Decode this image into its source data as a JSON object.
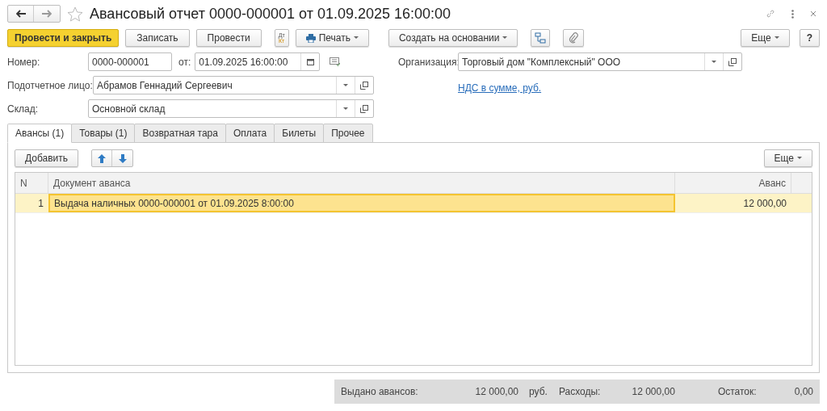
{
  "window": {
    "title": "Авансовый отчет 0000-000001 от 01.09.2025 16:00:00",
    "favorite": false
  },
  "toolbar": {
    "buttons": [
      {
        "kind": "primary",
        "label": "Провести и закрыть"
      },
      {
        "kind": "plain",
        "label": "Записать"
      },
      {
        "kind": "plain",
        "label": "Провести"
      },
      {
        "kind": "dtkt",
        "label_top": "Дт",
        "label_bottom": "Кт"
      },
      {
        "kind": "print",
        "label": "Печать"
      },
      {
        "kind": "dropdown",
        "label": "Создать на основании"
      },
      {
        "kind": "structure"
      },
      {
        "kind": "attach"
      }
    ],
    "more": "Еще",
    "help": "?"
  },
  "fields": {
    "number": {
      "label": "Номер:",
      "value": "0000-000001"
    },
    "date": {
      "label": "от:",
      "value": "01.09.2025 16:00:00"
    },
    "organization": {
      "label": "Организация:",
      "value": "Торговый дом \"Комплексный\" ООО"
    },
    "person": {
      "label": "Подотчетное лицо:",
      "value": "Абрамов Геннадий Сергеевич"
    },
    "vat_link": "НДС в сумме, руб.",
    "warehouse": {
      "label": "Склад:",
      "value": "Основной склад"
    }
  },
  "tabs": [
    {
      "label": "Авансы (1)",
      "selected": true
    },
    {
      "label": "Товары (1)",
      "selected": false
    },
    {
      "label": "Возвратная тара",
      "selected": false
    },
    {
      "label": "Оплата",
      "selected": false
    },
    {
      "label": "Билеты",
      "selected": false
    },
    {
      "label": "Прочее",
      "selected": false
    }
  ],
  "table_toolbar": {
    "add": "Добавить",
    "more": "Еще"
  },
  "table": {
    "columns": [
      "N",
      "Документ аванса",
      "Аванс"
    ],
    "rows": [
      {
        "n": "1",
        "document": "Выдача наличных 0000-000001 от 01.09.2025 8:00:00",
        "amount": "12 000,00",
        "selected": true
      }
    ]
  },
  "totals": {
    "issued_label": "Выдано авансов:",
    "issued": "12 000,00",
    "currency": "руб.",
    "expenses_label": "Расходы:",
    "expenses": "12 000,00",
    "rest_label": "Остаток:",
    "rest": "0,00"
  }
}
